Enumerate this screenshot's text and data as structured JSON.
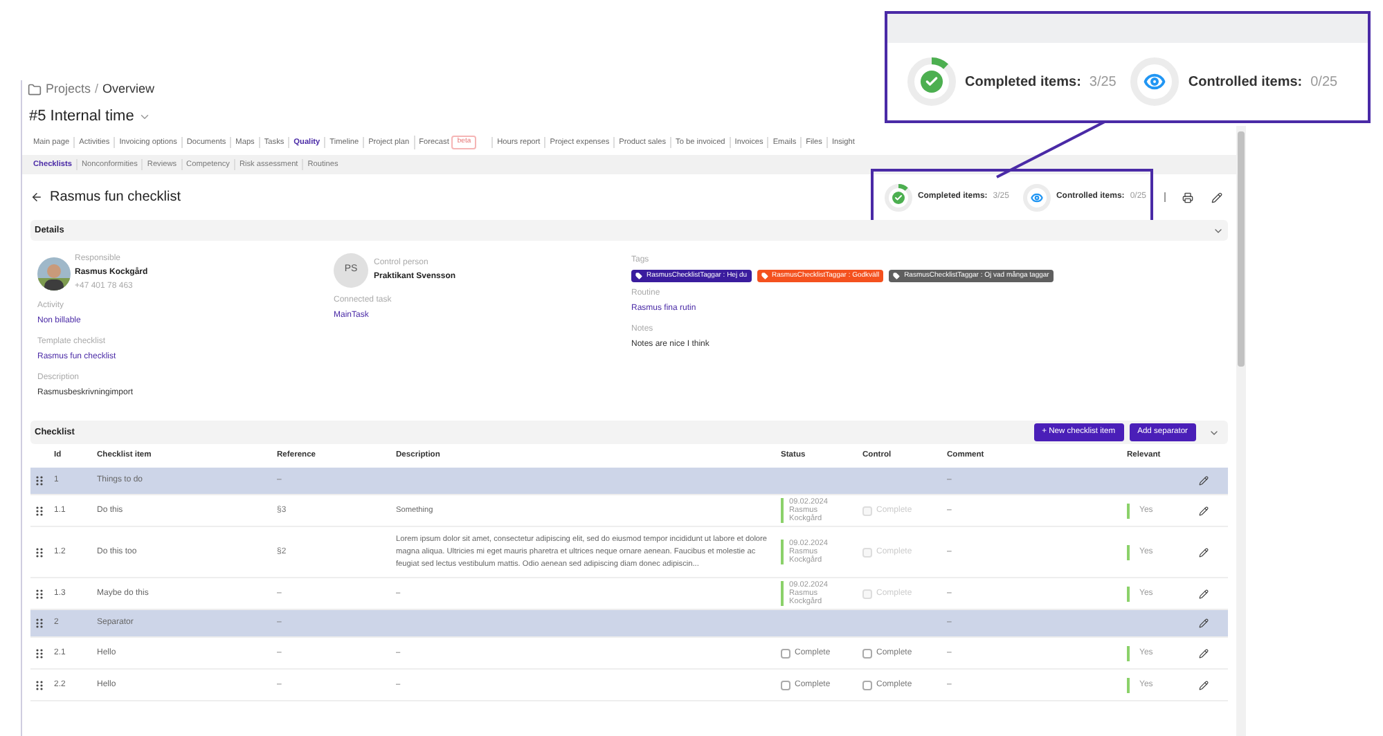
{
  "breadcrumb": {
    "parent": "Projects",
    "separator": "/",
    "current": "Overview"
  },
  "project_title": "#5 Internal time",
  "nav_tabs": [
    {
      "label": "Main page",
      "selected": false
    },
    {
      "label": "Activities",
      "selected": false
    },
    {
      "label": "Invoicing options",
      "selected": false
    },
    {
      "label": "Documents",
      "selected": false
    },
    {
      "label": "Maps",
      "selected": false
    },
    {
      "label": "Tasks",
      "selected": false
    },
    {
      "label": "Quality",
      "selected": true
    },
    {
      "label": "Timeline",
      "selected": false
    },
    {
      "label": "Project plan",
      "selected": false
    },
    {
      "label": "Forecast",
      "selected": false,
      "badge": "beta"
    },
    {
      "label": "Hours report",
      "selected": false
    },
    {
      "label": "Project expenses",
      "selected": false
    },
    {
      "label": "Product sales",
      "selected": false
    },
    {
      "label": "To be invoiced",
      "selected": false
    },
    {
      "label": "Invoices",
      "selected": false
    },
    {
      "label": "Emails",
      "selected": false
    },
    {
      "label": "Files",
      "selected": false
    },
    {
      "label": "Insight",
      "selected": false
    }
  ],
  "sub_tabs": [
    {
      "label": "Checklists",
      "selected": true
    },
    {
      "label": "Nonconformities",
      "selected": false
    },
    {
      "label": "Reviews",
      "selected": false
    },
    {
      "label": "Competency",
      "selected": false
    },
    {
      "label": "Risk assessment",
      "selected": false
    },
    {
      "label": "Routines",
      "selected": false
    }
  ],
  "page_title": "Rasmus fun checklist",
  "stats": [
    {
      "kind": "completed",
      "label": "Completed items:",
      "value": "3/25",
      "level": 0.12
    },
    {
      "kind": "controlled",
      "label": "Controlled items:",
      "value": "0/25",
      "level": 0
    }
  ],
  "zoom_callout": {
    "stats": [
      {
        "kind": "completed",
        "label": "Completed items:",
        "value": "3/25",
        "level": 0.12
      },
      {
        "kind": "controlled",
        "label": "Controlled items:",
        "value": "0/25",
        "level": 0
      }
    ]
  },
  "details": {
    "title": "Details",
    "responsible": {
      "label": "Responsible",
      "name": "Rasmus Kockgård",
      "phone": "+47 401 78 463"
    },
    "control_person": {
      "label": "Control person",
      "initials": "PS",
      "name": "Praktikant Svensson"
    },
    "activity": {
      "label": "Activity",
      "value": "Non billable"
    },
    "connected_task": {
      "label": "Connected task",
      "value": "MainTask"
    },
    "template_checklist": {
      "label": "Template checklist",
      "value": "Rasmus fun checklist"
    },
    "description": {
      "label": "Description",
      "value": "Rasmusbeskrivningimport"
    },
    "tags": {
      "label": "Tags",
      "items": [
        {
          "text": "RasmusChecklistTaggar : Hej du",
          "color": "#3a1c9e"
        },
        {
          "text": "RasmusChecklistTaggar : Godkväll",
          "color": "#f4511e"
        },
        {
          "text": "RasmusChecklistTaggar : Oj vad många taggar",
          "color": "#5f5f5f"
        }
      ]
    },
    "routine": {
      "label": "Routine",
      "value": "Rasmus fina rutin"
    },
    "notes": {
      "label": "Notes",
      "value": "Notes are nice I think"
    }
  },
  "checklist": {
    "title": "Checklist",
    "buttons": [
      "+ New checklist item",
      "Add separator"
    ],
    "columns": [
      "Id",
      "Checklist item",
      "Reference",
      "Description",
      "Status",
      "Control",
      "Comment",
      "Relevant"
    ],
    "rows": [
      {
        "kind": "separator",
        "id": "1",
        "item": "Things to do",
        "reference": "–",
        "comment": "–"
      },
      {
        "kind": "item",
        "id": "1.1",
        "item": "Do this",
        "reference": "§3",
        "description": "Something",
        "status": {
          "kind": "signed",
          "date": "09.02.2024",
          "name": "Rasmus Kockgård"
        },
        "control": {
          "label": "Complete",
          "checked": false,
          "disabled": true
        },
        "comment": "–",
        "relevant": "Yes"
      },
      {
        "kind": "item",
        "id": "1.2",
        "item": "Do this too",
        "reference": "§2",
        "description": "Lorem ipsum dolor sit amet, consectetur adipiscing elit, sed do eiusmod tempor incididunt ut labore et dolore magna aliqua. Ultricies mi eget mauris pharetra et ultrices neque ornare aenean. Faucibus et molestie ac feugiat sed lectus vestibulum mattis. Odio aenean sed adipiscing diam donec adipiscin...",
        "status": {
          "kind": "signed",
          "date": "09.02.2024",
          "name": "Rasmus Kockgård"
        },
        "control": {
          "label": "Complete",
          "checked": false,
          "disabled": true
        },
        "comment": "–",
        "relevant": "Yes"
      },
      {
        "kind": "item",
        "id": "1.3",
        "item": "Maybe do this",
        "reference": "–",
        "description": "–",
        "status": {
          "kind": "signed",
          "date": "09.02.2024",
          "name": "Rasmus Kockgård"
        },
        "control": {
          "label": "Complete",
          "checked": false,
          "disabled": true
        },
        "comment": "–",
        "relevant": "Yes"
      },
      {
        "kind": "separator",
        "id": "2",
        "item": "Separator",
        "reference": "–",
        "comment": "–"
      },
      {
        "kind": "item",
        "id": "2.1",
        "item": "Hello",
        "reference": "–",
        "description": "–",
        "status": {
          "kind": "checkbox",
          "label": "Complete",
          "checked": false
        },
        "control": {
          "label": "Complete",
          "checked": false,
          "disabled": false
        },
        "comment": "–",
        "relevant": "Yes"
      },
      {
        "kind": "item",
        "id": "2.2",
        "item": "Hello",
        "reference": "–",
        "description": "–",
        "status": {
          "kind": "checkbox",
          "label": "Complete",
          "checked": false
        },
        "control": {
          "label": "Complete",
          "checked": false,
          "disabled": false
        },
        "comment": "–",
        "relevant": "Yes"
      }
    ]
  }
}
